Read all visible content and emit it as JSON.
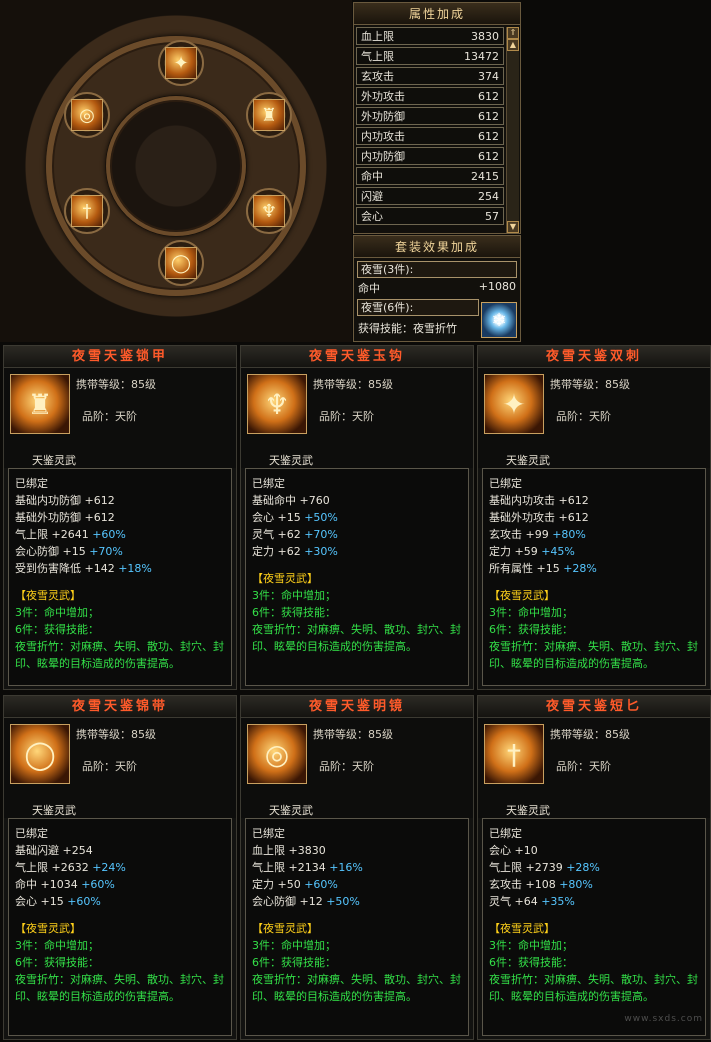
{
  "attributes": {
    "title": "属性加成",
    "rows": [
      {
        "label": "血上限",
        "value": "3830"
      },
      {
        "label": "气上限",
        "value": "13472"
      },
      {
        "label": "玄攻击",
        "value": "374"
      },
      {
        "label": "外功攻击",
        "value": "612"
      },
      {
        "label": "外功防御",
        "value": "612"
      },
      {
        "label": "内功攻击",
        "value": "612"
      },
      {
        "label": "内功防御",
        "value": "612"
      },
      {
        "label": "命中",
        "value": "2415"
      },
      {
        "label": "闪避",
        "value": "254"
      },
      {
        "label": "会心",
        "value": "57"
      }
    ]
  },
  "set_bonus": {
    "title": "套装效果加成",
    "three_piece": "夜雪(3件):",
    "hit_label": "命中",
    "hit_value": "+1080",
    "six_piece": "夜雪(6件):",
    "skill_line": "获得技能：夜雪折竹"
  },
  "wheel_slots": [
    {
      "name": "top",
      "icon": "dual-blade-icon"
    },
    {
      "name": "upper-left",
      "icon": "mirror-icon"
    },
    {
      "name": "upper-right",
      "icon": "armor-icon"
    },
    {
      "name": "lower-left",
      "icon": "dagger-icon"
    },
    {
      "name": "lower-right",
      "icon": "hook-icon"
    },
    {
      "name": "bottom",
      "icon": "belt-icon"
    }
  ],
  "cards": [
    {
      "title": "夜雪天鉴锁甲",
      "icon": "armor-icon",
      "level": "携带等级：85级",
      "rank": "品阶：天阶",
      "weapon": "天鉴灵武",
      "bound": "已绑定",
      "stats": [
        {
          "name": "基础内功防御",
          "val": "+612",
          "pct": ""
        },
        {
          "name": "基础外功防御",
          "val": "+612",
          "pct": ""
        },
        {
          "name": "气上限",
          "val": "+2641",
          "pct": "+60%"
        },
        {
          "name": "会心防御",
          "val": "+15",
          "pct": "+70%"
        },
        {
          "name": "受到伤害降低",
          "val": "+142",
          "pct": "+18%"
        }
      ],
      "set_name": "【夜雪灵武】",
      "set3": "3件：命中增加；",
      "set6": "6件：获得技能：",
      "skill_desc": "夜雪折竹：对麻痹、失明、散功、封穴、封印、眩晕的目标造成的伤害提高。"
    },
    {
      "title": "夜雪天鉴玉钩",
      "icon": "hook-icon",
      "level": "携带等级：85级",
      "rank": "品阶：天阶",
      "weapon": "天鉴灵武",
      "bound": "已绑定",
      "stats": [
        {
          "name": "基础命中",
          "val": "+760",
          "pct": ""
        },
        {
          "name": "会心",
          "val": "+15",
          "pct": "+50%"
        },
        {
          "name": "灵气",
          "val": "+62",
          "pct": "+70%"
        },
        {
          "name": "定力",
          "val": "+62",
          "pct": "+30%"
        }
      ],
      "set_name": "【夜雪灵武】",
      "set3": "3件：命中增加；",
      "set6": "6件：获得技能：",
      "skill_desc": "夜雪折竹：对麻痹、失明、散功、封穴、封印、眩晕的目标造成的伤害提高。"
    },
    {
      "title": "夜雪天鉴双刺",
      "icon": "dual-blade-icon",
      "level": "携带等级：85级",
      "rank": "品阶：天阶",
      "weapon": "天鉴灵武",
      "bound": "已绑定",
      "stats": [
        {
          "name": "基础内功攻击",
          "val": "+612",
          "pct": ""
        },
        {
          "name": "基础外功攻击",
          "val": "+612",
          "pct": ""
        },
        {
          "name": "玄攻击",
          "val": "+99",
          "pct": "+80%"
        },
        {
          "name": "定力",
          "val": "+59",
          "pct": "+45%"
        },
        {
          "name": "所有属性",
          "val": "+15",
          "pct": "+28%"
        }
      ],
      "set_name": "【夜雪灵武】",
      "set3": "3件：命中增加；",
      "set6": "6件：获得技能：",
      "skill_desc": "夜雪折竹：对麻痹、失明、散功、封穴、封印、眩晕的目标造成的伤害提高。"
    },
    {
      "title": "夜雪天鉴锦带",
      "icon": "belt-icon",
      "level": "携带等级：85级",
      "rank": "品阶：天阶",
      "weapon": "天鉴灵武",
      "bound": "已绑定",
      "stats": [
        {
          "name": "基础闪避",
          "val": "+254",
          "pct": ""
        },
        {
          "name": "气上限",
          "val": "+2632",
          "pct": "+24%"
        },
        {
          "name": "命中",
          "val": "+1034",
          "pct": "+60%"
        },
        {
          "name": "会心",
          "val": "+15",
          "pct": "+60%"
        }
      ],
      "set_name": "【夜雪灵武】",
      "set3": "3件：命中增加；",
      "set6": "6件：获得技能：",
      "skill_desc": "夜雪折竹：对麻痹、失明、散功、封穴、封印、眩晕的目标造成的伤害提高。"
    },
    {
      "title": "夜雪天鉴明镜",
      "icon": "mirror-icon",
      "level": "携带等级：85级",
      "rank": "品阶：天阶",
      "weapon": "天鉴灵武",
      "bound": "已绑定",
      "stats": [
        {
          "name": "血上限",
          "val": "+3830",
          "pct": ""
        },
        {
          "name": "气上限",
          "val": "+2134",
          "pct": "+16%"
        },
        {
          "name": "定力",
          "val": "+50",
          "pct": "+60%"
        },
        {
          "name": "会心防御",
          "val": "+12",
          "pct": "+50%"
        }
      ],
      "set_name": "【夜雪灵武】",
      "set3": "3件：命中增加；",
      "set6": "6件：获得技能：",
      "skill_desc": "夜雪折竹：对麻痹、失明、散功、封穴、封印、眩晕的目标造成的伤害提高。"
    },
    {
      "title": "夜雪天鉴短匕",
      "icon": "dagger-icon",
      "level": "携带等级：85级",
      "rank": "品阶：天阶",
      "weapon": "天鉴灵武",
      "bound": "已绑定",
      "stats": [
        {
          "name": "会心",
          "val": "+10",
          "pct": ""
        },
        {
          "name": "气上限",
          "val": "+2739",
          "pct": "+28%"
        },
        {
          "name": "玄攻击",
          "val": "+108",
          "pct": "+80%"
        },
        {
          "name": "灵气",
          "val": "+64",
          "pct": "+35%"
        }
      ],
      "set_name": "【夜雪灵武】",
      "set3": "3件：命中增加；",
      "set6": "6件：获得技能：",
      "skill_desc": "夜雪折竹：对麻痹、失明、散功、封穴、封印、眩晕的目标造成的伤害提高。"
    }
  ],
  "watermark": "www.sxds.com"
}
